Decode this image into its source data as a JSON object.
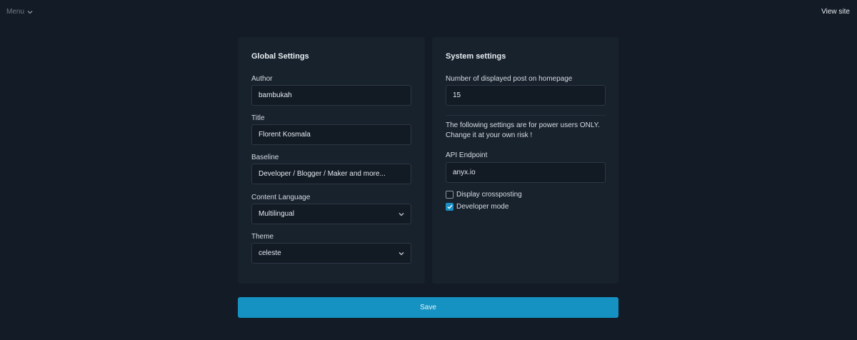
{
  "topbar": {
    "menu_label": "Menu",
    "view_site_label": "View site"
  },
  "global_settings": {
    "title": "Global Settings",
    "author": {
      "label": "Author",
      "value": "bambukah"
    },
    "site_title": {
      "label": "Title",
      "value": "Florent Kosmala"
    },
    "baseline": {
      "label": "Baseline",
      "value": "Developer / Blogger / Maker and more..."
    },
    "content_language": {
      "label": "Content Language",
      "value": "Multilingual"
    },
    "theme": {
      "label": "Theme",
      "value": "celeste"
    }
  },
  "system_settings": {
    "title": "System settings",
    "posts_on_homepage": {
      "label": "Number of displayed post on homepage",
      "value": "15"
    },
    "note_line1": "The following settings are for power users ONLY.",
    "note_line2": "Change it at your own risk !",
    "api_endpoint": {
      "label": "API Endpoint",
      "value": "anyx.io"
    },
    "display_crossposting": {
      "label": "Display crossposting",
      "checked": false
    },
    "developer_mode": {
      "label": "Developer mode",
      "checked": true
    }
  },
  "actions": {
    "save_label": "Save"
  },
  "colors": {
    "background": "#131b26",
    "card": "#18222d",
    "accent": "#1592c2"
  }
}
